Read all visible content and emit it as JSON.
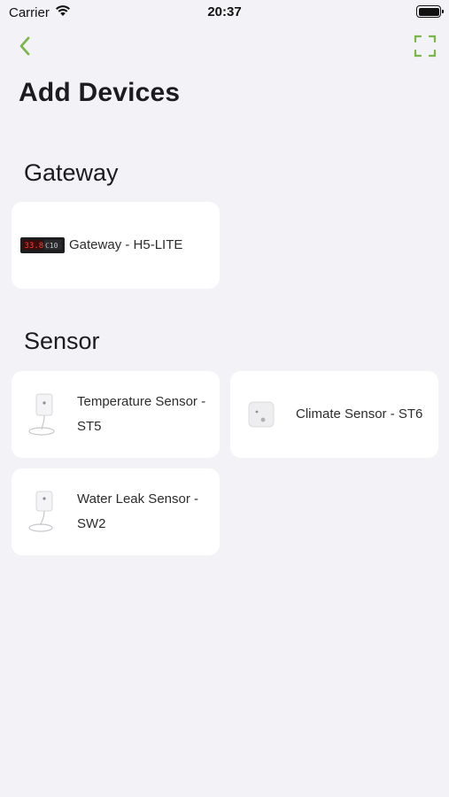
{
  "status_bar": {
    "carrier": "Carrier",
    "time": "20:37"
  },
  "nav": {
    "back_icon": "chevron-left-icon",
    "scan_icon": "scan-frame-icon",
    "accent_color": "#7ab648"
  },
  "page": {
    "title": "Add Devices"
  },
  "sections": {
    "gateway": {
      "title": "Gateway",
      "items": [
        {
          "label": "Gateway - H5-LITE",
          "icon": "gateway-device-icon"
        }
      ]
    },
    "sensor": {
      "title": "Sensor",
      "items": [
        {
          "label": "Temperature Sensor - ST5",
          "icon": "temperature-sensor-icon"
        },
        {
          "label": "Climate Sensor - ST6",
          "icon": "climate-sensor-icon"
        },
        {
          "label": "Water Leak Sensor - SW2",
          "icon": "water-leak-sensor-icon"
        }
      ]
    }
  }
}
